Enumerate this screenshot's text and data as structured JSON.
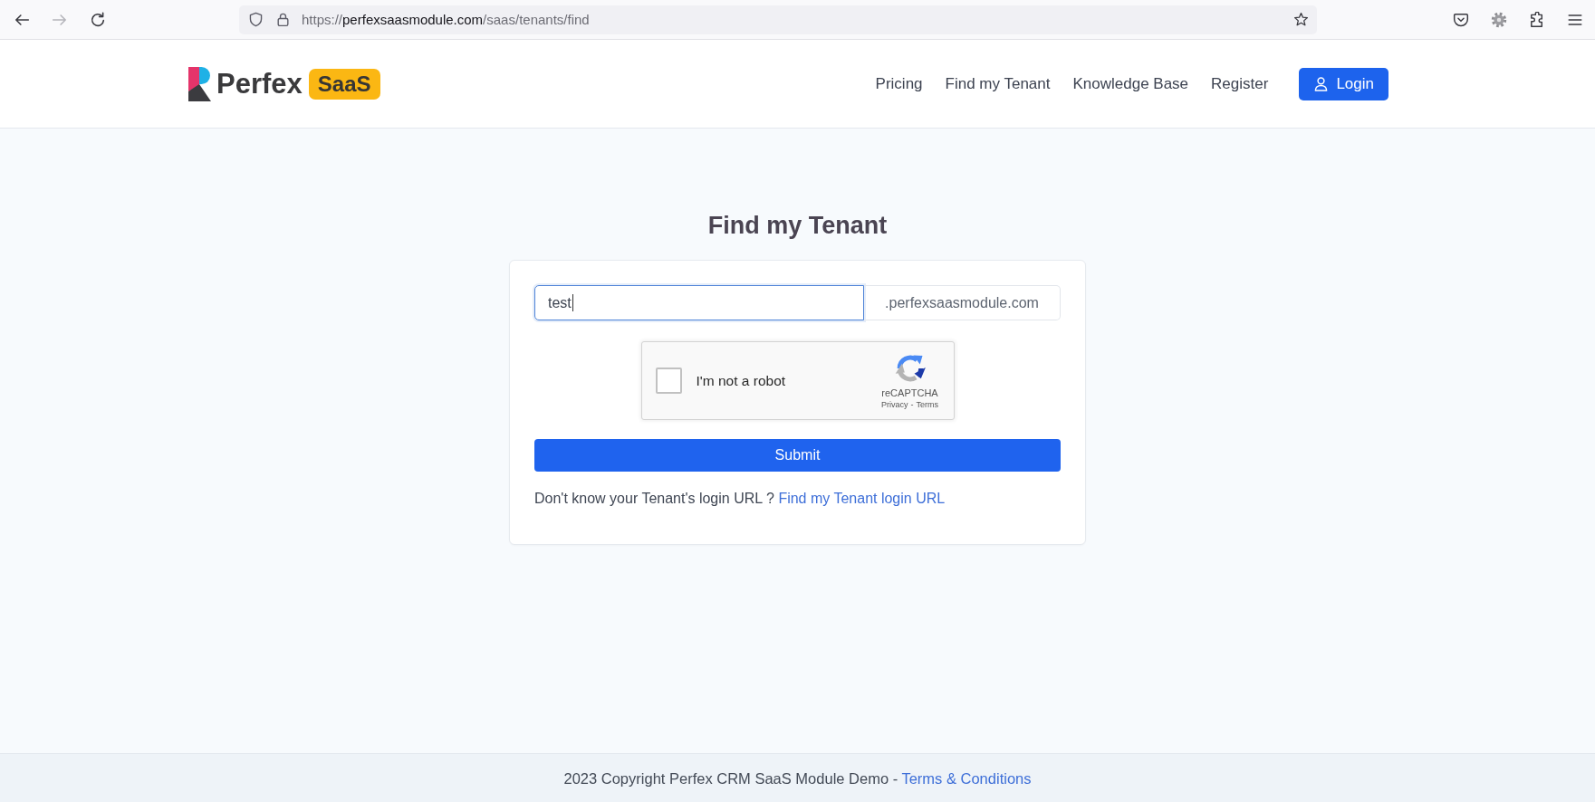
{
  "browser": {
    "nav_buttons": [
      {
        "kind": "back",
        "disabled": false
      },
      {
        "kind": "forward",
        "disabled": true
      },
      {
        "kind": "reload",
        "disabled": false
      }
    ],
    "url": {
      "scheme": "https://",
      "host": "perfexsaasmodule.com",
      "path": "/saas/tenants/find"
    }
  },
  "header": {
    "logo": {
      "wordmark": "Perfex",
      "badge": "SaaS"
    },
    "nav": [
      {
        "label": "Pricing"
      },
      {
        "label": "Find my Tenant"
      },
      {
        "label": "Knowledge Base"
      },
      {
        "label": "Register"
      }
    ],
    "login_button": {
      "label": "Login"
    }
  },
  "form": {
    "title": "Find my Tenant",
    "subdomain_field": {
      "value": "test",
      "focused": true
    },
    "domain_suffix": ".perfexsaasmodule.com",
    "captcha": {
      "label": "I'm not a robot",
      "checked": false,
      "brand": "reCAPTCHA",
      "links": [
        "Privacy",
        "Terms"
      ],
      "separator": "-"
    },
    "submit": "Submit",
    "help": {
      "text": "Don't know your Tenant's login URL ?",
      "link": "Find my Tenant login URL"
    }
  },
  "footer": {
    "text": "2023 Copyright Perfex CRM SaaS Module Demo -",
    "link": "Terms & Conditions"
  }
}
